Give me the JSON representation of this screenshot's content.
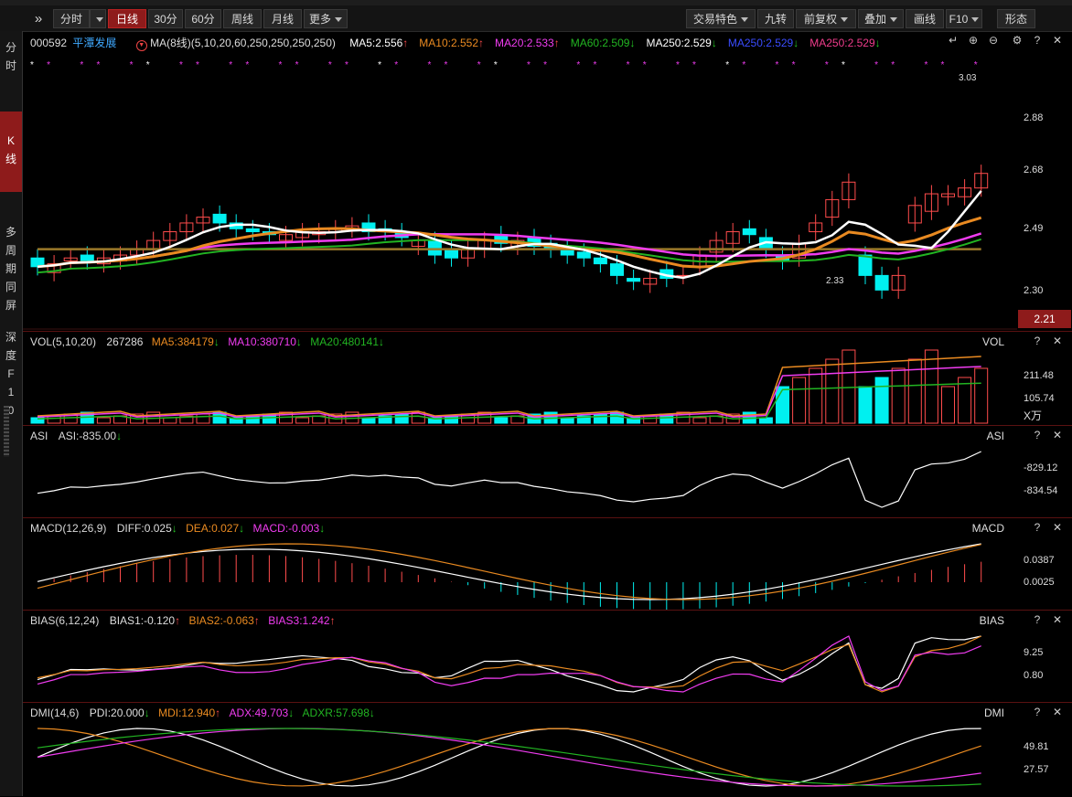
{
  "toolbar": {
    "periods": [
      "分时",
      "日线",
      "30分",
      "60分",
      "周线",
      "月线",
      "更多"
    ],
    "active_period": "日线",
    "right_buttons": [
      "交易特色",
      "九转",
      "前复权",
      "叠加",
      "画线",
      "F10",
      "形态"
    ]
  },
  "sidebar": {
    "items": [
      "分时",
      "K线",
      "多周期同屏",
      "深度F10"
    ]
  },
  "kline": {
    "code": "000592",
    "name": "平潭发展",
    "ma_label": "MA(8线)(5,10,20,60,250,250,250,250)",
    "ma_values": [
      {
        "label": "MA5:2.556",
        "color": "#ffffff",
        "dir": "up"
      },
      {
        "label": "MA10:2.552",
        "color": "#e98a21",
        "dir": "up"
      },
      {
        "label": "MA20:2.533",
        "color": "#f03cf0",
        "dir": "up"
      },
      {
        "label": "MA60:2.509",
        "color": "#22b422",
        "dir": "down"
      },
      {
        "label": "MA250:2.529",
        "color": "#ffffff",
        "dir": "down"
      },
      {
        "label": "MA250:2.529",
        "color": "#3a4cff",
        "dir": "down"
      },
      {
        "label": "MA250:2.529",
        "color": "#f03c8c",
        "dir": "down"
      }
    ],
    "y_ticks": [
      "2.88",
      "2.68",
      "2.49",
      "2.30"
    ],
    "current_price": "2.21",
    "high_label": "3.03",
    "low_label": "2.33"
  },
  "vol": {
    "title": "VOL(5,10,20)",
    "value": "267286",
    "ma5": "MA5:384179",
    "ma10": "MA10:380710",
    "ma20": "MA20:480141",
    "name": "VOL",
    "y_ticks": [
      "211.48",
      "105.74"
    ],
    "unit": "X万"
  },
  "asi": {
    "title": "ASI",
    "value": "ASI:-835.00",
    "name": "ASI",
    "y_ticks": [
      "-829.12",
      "-834.54"
    ]
  },
  "macd": {
    "title": "MACD(12,26,9)",
    "diff": "DIFF:0.025",
    "dea": "DEA:0.027",
    "macd": "MACD:-0.003",
    "name": "MACD",
    "y_ticks": [
      "0.0387",
      "0.0025"
    ]
  },
  "bias": {
    "title": "BIAS(6,12,24)",
    "bias1": "BIAS1:-0.120",
    "bias2": "BIAS2:-0.063",
    "bias3": "BIAS3:1.242",
    "name": "BIAS",
    "y_ticks": [
      "9.25",
      "0.80"
    ]
  },
  "dmi": {
    "title": "DMI(14,6)",
    "pdi": "PDI:20.000",
    "mdi": "MDI:12.940",
    "adx": "ADX:49.703",
    "adxr": "ADXR:57.698",
    "name": "DMI",
    "y_ticks": [
      "49.81",
      "27.57"
    ]
  },
  "colors": {
    "up": "#ff4c4c",
    "down": "#00f0f0",
    "ma5": "#ffffff",
    "ma10": "#e98a21",
    "ma20": "#f03cf0",
    "ma60": "#22b422",
    "ma250": "#9c7a2a",
    "grid": "#3a0f0f",
    "active": "#8e1b1b"
  }
}
